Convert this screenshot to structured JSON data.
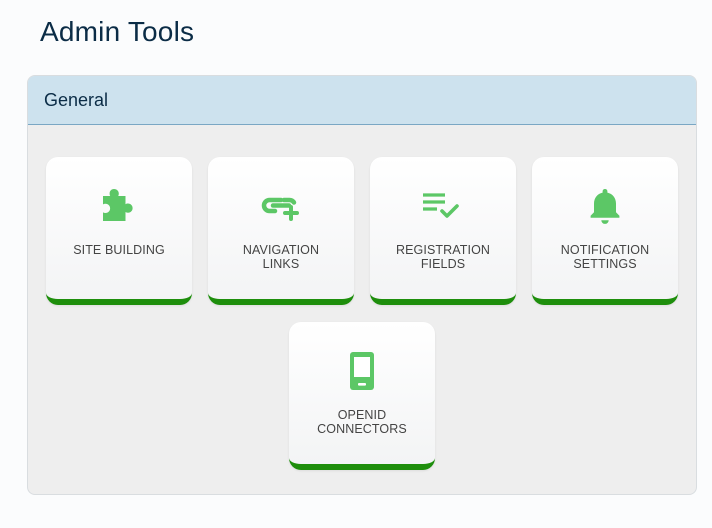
{
  "page": {
    "title": "Admin Tools"
  },
  "accent_color": "#1e8e0c",
  "icon_color": "#5cc766",
  "header_color": "#cde2ee",
  "section": {
    "title": "General",
    "tiles": [
      {
        "label_line1": "SITE BUILDING",
        "label_line2": "",
        "icon": "puzzle-icon"
      },
      {
        "label_line1": "NAVIGATION",
        "label_line2": "LINKS",
        "icon": "link-add-icon"
      },
      {
        "label_line1": "REGISTRATION",
        "label_line2": "FIELDS",
        "icon": "list-check-icon"
      },
      {
        "label_line1": "NOTIFICATION",
        "label_line2": "SETTINGS",
        "icon": "bell-icon"
      },
      {
        "label_line1": "OPENID",
        "label_line2": "CONNECTORS",
        "icon": "phone-icon"
      }
    ]
  }
}
